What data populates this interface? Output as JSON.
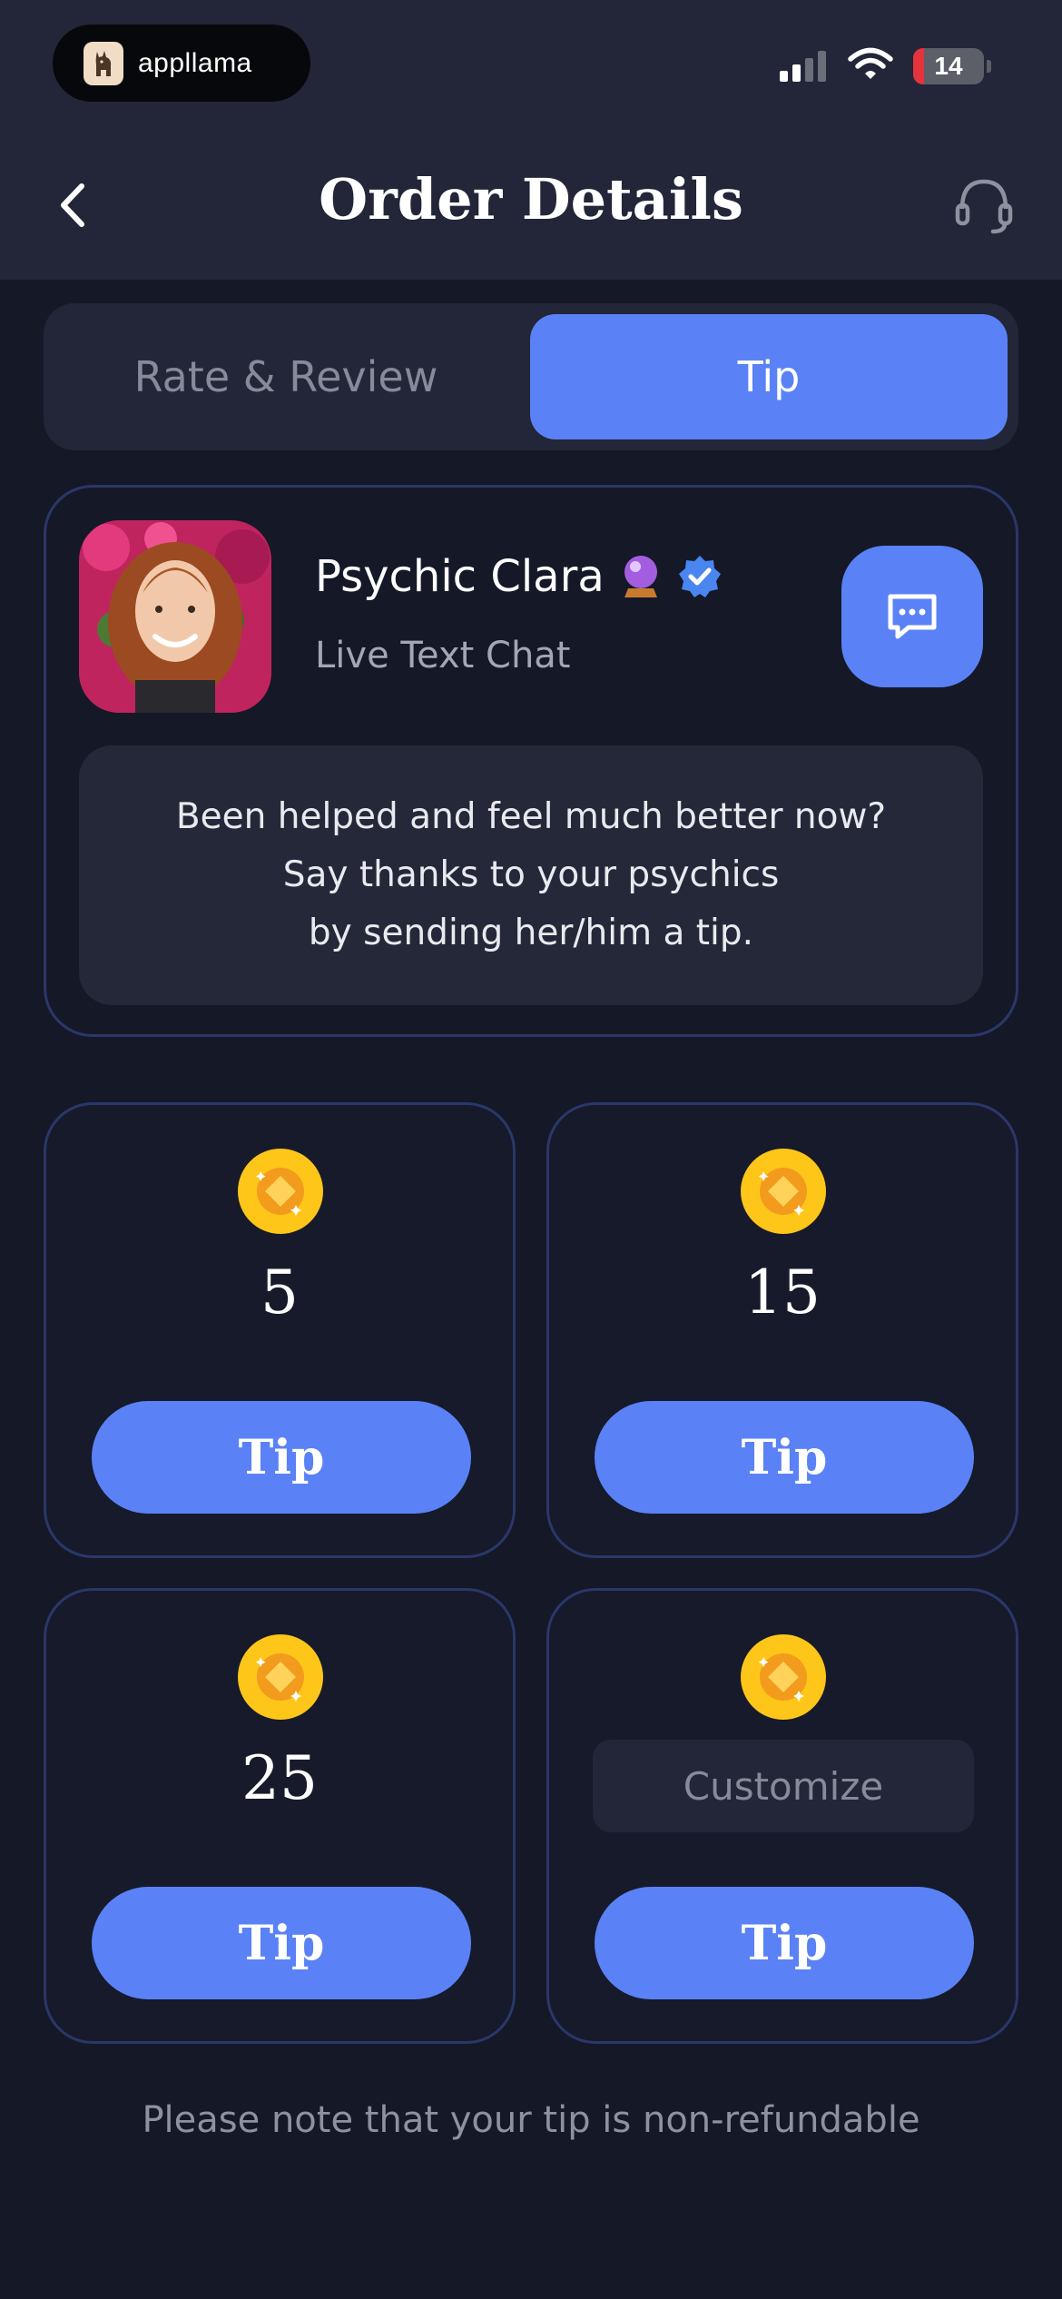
{
  "status_bar": {
    "app_pill_label": "appllama",
    "battery_level": "14"
  },
  "header": {
    "title": "Order Details",
    "back_icon": "chevron-left-icon",
    "support_icon": "headset-icon"
  },
  "tabs": [
    {
      "label": "Rate & Review",
      "active": false
    },
    {
      "label": "Tip",
      "active": true
    }
  ],
  "psychic": {
    "name": "Psychic Clara",
    "badges": [
      "crystal-ball-icon",
      "verified-badge-icon"
    ],
    "service": "Live Text Chat",
    "chat_icon": "chat-bubble-icon",
    "message_lines": [
      "Been helped and feel much better now?",
      "Say thanks to your psychics",
      "by sending her/him a tip."
    ]
  },
  "tip_options": [
    {
      "amount": "5",
      "button_label": "Tip"
    },
    {
      "amount": "15",
      "button_label": "Tip"
    },
    {
      "amount": "25",
      "button_label": "Tip"
    },
    {
      "amount": "",
      "placeholder": "Customize",
      "button_label": "Tip"
    }
  ],
  "footer_note": "Please note that your tip is non-refundable",
  "colors": {
    "background": "#151827",
    "header_bg": "#222638",
    "accent": "#5a82f6",
    "card_border": "#2a3769",
    "coin": "#ffc61a"
  }
}
